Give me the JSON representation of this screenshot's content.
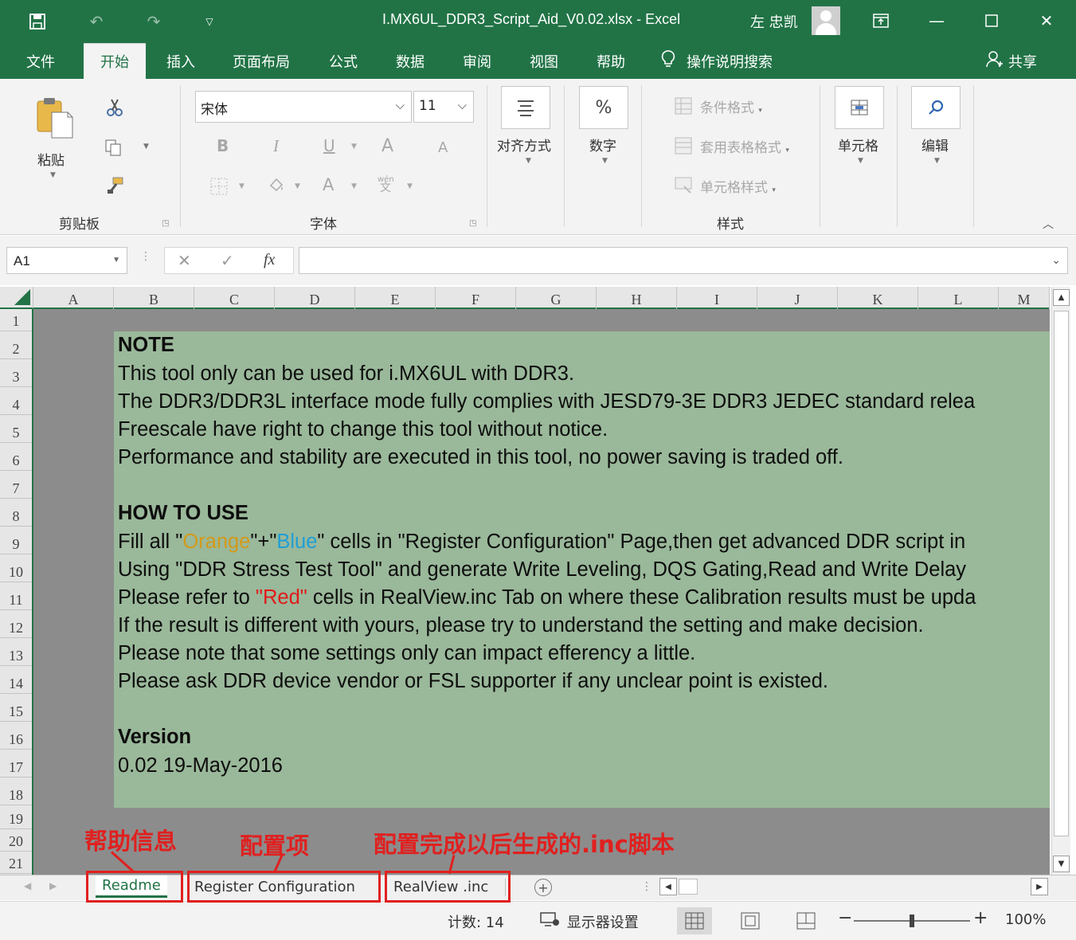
{
  "window": {
    "title": "I.MX6UL_DDR3_Script_Aid_V0.02.xlsx  -  Excel",
    "user": "左 忠凯"
  },
  "quick_access": {
    "save_icon": "save-icon",
    "undo_icon": "undo-icon",
    "redo_icon": "redo-icon",
    "customize_icon": "dropdown-icon"
  },
  "menu": {
    "tabs": [
      "文件",
      "开始",
      "插入",
      "页面布局",
      "公式",
      "数据",
      "审阅",
      "视图",
      "帮助"
    ],
    "active_tab": "开始",
    "search_label": "操作说明搜索",
    "share_label": "共享"
  },
  "ribbon": {
    "clipboard": {
      "paste_label": "粘贴",
      "group_label": "剪贴板"
    },
    "font": {
      "font_name": "宋体",
      "font_size": "11",
      "group_label": "字体",
      "bold": "B",
      "italic": "I",
      "underline": "U",
      "grow": "A",
      "shrink": "A",
      "color_a": "A",
      "phonetic_top": "wén",
      "phonetic_bottom": "文"
    },
    "alignment": {
      "label": "对齐方式"
    },
    "number": {
      "label": "数字",
      "symbol": "%"
    },
    "styles": {
      "conditional": "条件格式",
      "table": "套用表格格式",
      "cell": "单元格样式",
      "group_label": "样式"
    },
    "cells": {
      "label": "单元格"
    },
    "editing": {
      "label": "编辑"
    }
  },
  "formula_bar": {
    "name_box": "A1",
    "cancel_icon": "close-icon",
    "enter_icon": "check-icon",
    "fx_label": "fx",
    "value": ""
  },
  "grid": {
    "columns": [
      "A",
      "B",
      "C",
      "D",
      "E",
      "F",
      "G",
      "H",
      "I",
      "J",
      "K",
      "L",
      "M"
    ],
    "rows": [
      "1",
      "2",
      "3",
      "4",
      "5",
      "6",
      "7",
      "8",
      "9",
      "10",
      "11",
      "12",
      "13",
      "14",
      "15",
      "16",
      "17",
      "18",
      "19",
      "20",
      "21"
    ],
    "content": {
      "note_heading": "NOTE",
      "note_1": "This tool only can be used for i.MX6UL with DDR3.",
      "note_2": "The DDR3/DDR3L interface mode fully complies with JESD79-3E DDR3 JEDEC standard relea",
      "note_3": "Freescale have right to change this tool without notice.",
      "note_4": "Performance and stability are executed in this tool, no power saving is traded off.",
      "howto_heading": "HOW TO USE",
      "howto_1_a": "Fill all \"",
      "howto_1_orange": "Orange",
      "howto_1_b": "\"+\"",
      "howto_1_blue": "Blue",
      "howto_1_c": "\" cells in \"Register Configuration\" Page,then get advanced DDR script in",
      "howto_2": "Using \"DDR Stress Test Tool\" and generate Write Leveling, DQS Gating,Read and Write Delay",
      "howto_3_a": "Please refer to ",
      "howto_3_red": "\"Red\"",
      "howto_3_b": " cells in RealView.inc Tab on where these Calibration results must be upda",
      "howto_4": "If the result is different with yours, please try to understand the setting and make decision.",
      "howto_5": "Please note that some settings only can impact efferency a little.",
      "howto_6": "Please ask DDR device vendor or FSL supporter if any unclear point is existed.",
      "version_heading": "Version",
      "version_value": "0.02 19-May-2016"
    }
  },
  "sheets": {
    "tabs": [
      "Readme",
      "Register Configuration",
      "RealView .inc"
    ],
    "active": "Readme",
    "add_icon": "plus-circle-icon"
  },
  "annotations": {
    "readme_note": "帮助信息",
    "config_note": "配置项",
    "inc_note": "配置完成以后生成的.inc脚本",
    "color": "#e0201f"
  },
  "status": {
    "count": "计数: 14",
    "display_settings": "显示器设置",
    "zoom": "100%",
    "zoom_fraction": 0.5
  },
  "colors": {
    "excel_green": "#217346",
    "cell_green": "#9ab89a",
    "cell_gray": "#8c8c8c",
    "orange_text": "#d39a1a",
    "blue_text": "#1f9ed6",
    "red_text": "#e01a1a"
  }
}
